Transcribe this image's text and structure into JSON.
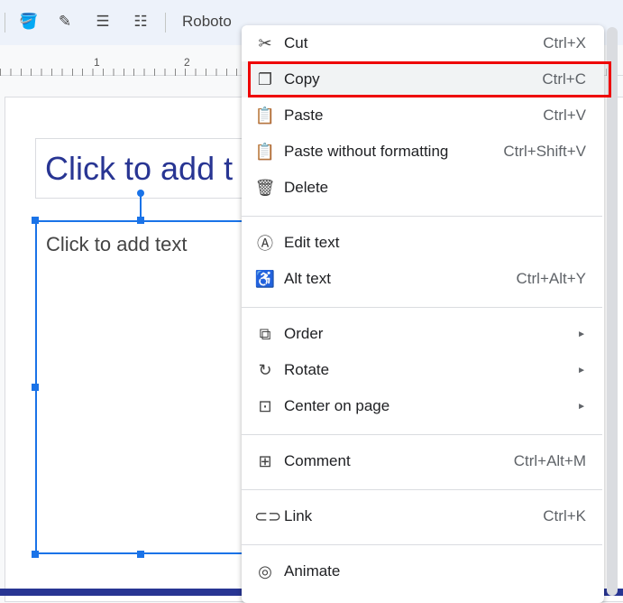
{
  "toolbar": {
    "font": "Roboto",
    "icons": [
      "paint-bucket-icon",
      "pen-icon",
      "line-weight-icon",
      "line-dash-icon"
    ]
  },
  "ruler": {
    "marks": [
      "1",
      "2"
    ]
  },
  "slide": {
    "title_placeholder": "Click to add t",
    "body_placeholder": "Click to add text"
  },
  "menu": {
    "items": [
      {
        "icon": "scissors-icon",
        "glyph": "✂",
        "label": "Cut",
        "shortcut": "Ctrl+X"
      },
      {
        "icon": "copy-icon",
        "glyph": "❐",
        "label": "Copy",
        "shortcut": "Ctrl+C",
        "highlighted": true
      },
      {
        "icon": "clipboard-icon",
        "glyph": "📋",
        "label": "Paste",
        "shortcut": "Ctrl+V"
      },
      {
        "icon": "clipboard-format-icon",
        "glyph": "📋",
        "label": "Paste without formatting",
        "shortcut": "Ctrl+Shift+V"
      },
      {
        "icon": "trash-icon",
        "glyph": "🗑",
        "label": "Delete",
        "shortcut": ""
      },
      {
        "icon": "edit-text-icon",
        "glyph": "Ⓐ",
        "label": "Edit text",
        "shortcut": ""
      },
      {
        "icon": "accessibility-icon",
        "glyph": "♿",
        "label": "Alt text",
        "shortcut": "Ctrl+Alt+Y"
      },
      {
        "icon": "order-icon",
        "glyph": "⧉",
        "label": "Order",
        "submenu": true
      },
      {
        "icon": "rotate-icon",
        "glyph": "↻",
        "label": "Rotate",
        "submenu": true
      },
      {
        "icon": "center-icon",
        "glyph": "⊡",
        "label": "Center on page",
        "submenu": true
      },
      {
        "icon": "comment-icon",
        "glyph": "⊞",
        "label": "Comment",
        "shortcut": "Ctrl+Alt+M"
      },
      {
        "icon": "link-icon",
        "glyph": "⊂⊃",
        "label": "Link",
        "shortcut": "Ctrl+K"
      },
      {
        "icon": "animate-icon",
        "glyph": "◎",
        "label": "Animate",
        "shortcut": ""
      }
    ],
    "submenu_arrow": "►"
  },
  "colors": {
    "accent": "#1a73e8",
    "highlight_outline": "#e00000",
    "title": "#283593"
  }
}
